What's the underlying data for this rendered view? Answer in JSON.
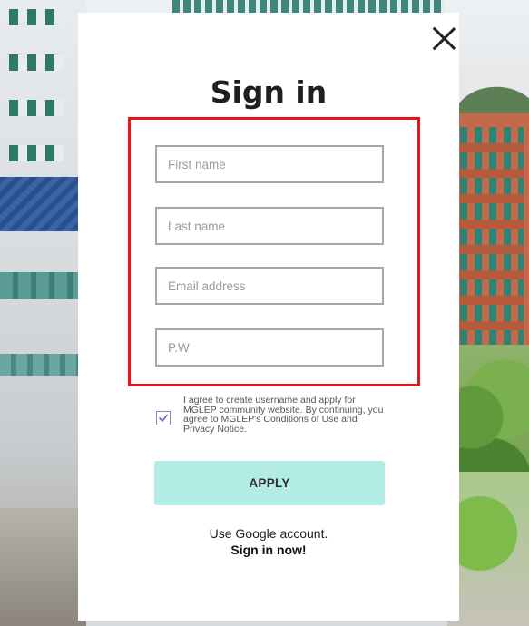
{
  "page": {
    "title": "Sign in",
    "accent_color": "#b2ece4",
    "highlight_color": "#e8141a"
  },
  "form": {
    "first_name_placeholder": "First name",
    "last_name_placeholder": "Last name",
    "email_placeholder": "Email address",
    "password_placeholder": "P.W"
  },
  "agreement": {
    "checked": true,
    "text": "I agree to create username and apply for MGLEP community website. By continuing, you agree to MGLEP's Conditions of Use and Privacy Notice."
  },
  "actions": {
    "apply_label": "APPLY",
    "google_text": "Use Google account.",
    "signin_now_label": "Sign in now!"
  },
  "icons": {
    "close": "close-icon",
    "check": "check-icon"
  }
}
